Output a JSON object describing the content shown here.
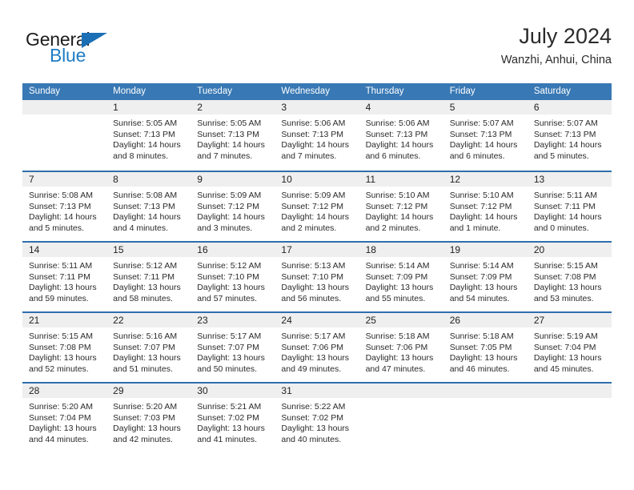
{
  "brand": {
    "word_one": "General",
    "word_two": "Blue",
    "triangle_color": "#1a6fb5",
    "blue_text_color": "#1f7dc4"
  },
  "header": {
    "title": "July 2024",
    "subtitle": "Wanzhi, Anhui, China"
  },
  "theme": {
    "header_bar_color": "#3878b4",
    "row_divider_color": "#2f6fad",
    "day_number_band_color": "#efefef"
  },
  "weekday_headers": [
    "Sunday",
    "Monday",
    "Tuesday",
    "Wednesday",
    "Thursday",
    "Friday",
    "Saturday"
  ],
  "weeks": [
    [
      {
        "day": "",
        "lines": []
      },
      {
        "day": "1",
        "lines": [
          "Sunrise: 5:05 AM",
          "Sunset: 7:13 PM",
          "Daylight: 14 hours",
          "and 8 minutes."
        ]
      },
      {
        "day": "2",
        "lines": [
          "Sunrise: 5:05 AM",
          "Sunset: 7:13 PM",
          "Daylight: 14 hours",
          "and 7 minutes."
        ]
      },
      {
        "day": "3",
        "lines": [
          "Sunrise: 5:06 AM",
          "Sunset: 7:13 PM",
          "Daylight: 14 hours",
          "and 7 minutes."
        ]
      },
      {
        "day": "4",
        "lines": [
          "Sunrise: 5:06 AM",
          "Sunset: 7:13 PM",
          "Daylight: 14 hours",
          "and 6 minutes."
        ]
      },
      {
        "day": "5",
        "lines": [
          "Sunrise: 5:07 AM",
          "Sunset: 7:13 PM",
          "Daylight: 14 hours",
          "and 6 minutes."
        ]
      },
      {
        "day": "6",
        "lines": [
          "Sunrise: 5:07 AM",
          "Sunset: 7:13 PM",
          "Daylight: 14 hours",
          "and 5 minutes."
        ]
      }
    ],
    [
      {
        "day": "7",
        "lines": [
          "Sunrise: 5:08 AM",
          "Sunset: 7:13 PM",
          "Daylight: 14 hours",
          "and 5 minutes."
        ]
      },
      {
        "day": "8",
        "lines": [
          "Sunrise: 5:08 AM",
          "Sunset: 7:13 PM",
          "Daylight: 14 hours",
          "and 4 minutes."
        ]
      },
      {
        "day": "9",
        "lines": [
          "Sunrise: 5:09 AM",
          "Sunset: 7:12 PM",
          "Daylight: 14 hours",
          "and 3 minutes."
        ]
      },
      {
        "day": "10",
        "lines": [
          "Sunrise: 5:09 AM",
          "Sunset: 7:12 PM",
          "Daylight: 14 hours",
          "and 2 minutes."
        ]
      },
      {
        "day": "11",
        "lines": [
          "Sunrise: 5:10 AM",
          "Sunset: 7:12 PM",
          "Daylight: 14 hours",
          "and 2 minutes."
        ]
      },
      {
        "day": "12",
        "lines": [
          "Sunrise: 5:10 AM",
          "Sunset: 7:12 PM",
          "Daylight: 14 hours",
          "and 1 minute."
        ]
      },
      {
        "day": "13",
        "lines": [
          "Sunrise: 5:11 AM",
          "Sunset: 7:11 PM",
          "Daylight: 14 hours",
          "and 0 minutes."
        ]
      }
    ],
    [
      {
        "day": "14",
        "lines": [
          "Sunrise: 5:11 AM",
          "Sunset: 7:11 PM",
          "Daylight: 13 hours",
          "and 59 minutes."
        ]
      },
      {
        "day": "15",
        "lines": [
          "Sunrise: 5:12 AM",
          "Sunset: 7:11 PM",
          "Daylight: 13 hours",
          "and 58 minutes."
        ]
      },
      {
        "day": "16",
        "lines": [
          "Sunrise: 5:12 AM",
          "Sunset: 7:10 PM",
          "Daylight: 13 hours",
          "and 57 minutes."
        ]
      },
      {
        "day": "17",
        "lines": [
          "Sunrise: 5:13 AM",
          "Sunset: 7:10 PM",
          "Daylight: 13 hours",
          "and 56 minutes."
        ]
      },
      {
        "day": "18",
        "lines": [
          "Sunrise: 5:14 AM",
          "Sunset: 7:09 PM",
          "Daylight: 13 hours",
          "and 55 minutes."
        ]
      },
      {
        "day": "19",
        "lines": [
          "Sunrise: 5:14 AM",
          "Sunset: 7:09 PM",
          "Daylight: 13 hours",
          "and 54 minutes."
        ]
      },
      {
        "day": "20",
        "lines": [
          "Sunrise: 5:15 AM",
          "Sunset: 7:08 PM",
          "Daylight: 13 hours",
          "and 53 minutes."
        ]
      }
    ],
    [
      {
        "day": "21",
        "lines": [
          "Sunrise: 5:15 AM",
          "Sunset: 7:08 PM",
          "Daylight: 13 hours",
          "and 52 minutes."
        ]
      },
      {
        "day": "22",
        "lines": [
          "Sunrise: 5:16 AM",
          "Sunset: 7:07 PM",
          "Daylight: 13 hours",
          "and 51 minutes."
        ]
      },
      {
        "day": "23",
        "lines": [
          "Sunrise: 5:17 AM",
          "Sunset: 7:07 PM",
          "Daylight: 13 hours",
          "and 50 minutes."
        ]
      },
      {
        "day": "24",
        "lines": [
          "Sunrise: 5:17 AM",
          "Sunset: 7:06 PM",
          "Daylight: 13 hours",
          "and 49 minutes."
        ]
      },
      {
        "day": "25",
        "lines": [
          "Sunrise: 5:18 AM",
          "Sunset: 7:06 PM",
          "Daylight: 13 hours",
          "and 47 minutes."
        ]
      },
      {
        "day": "26",
        "lines": [
          "Sunrise: 5:18 AM",
          "Sunset: 7:05 PM",
          "Daylight: 13 hours",
          "and 46 minutes."
        ]
      },
      {
        "day": "27",
        "lines": [
          "Sunrise: 5:19 AM",
          "Sunset: 7:04 PM",
          "Daylight: 13 hours",
          "and 45 minutes."
        ]
      }
    ],
    [
      {
        "day": "28",
        "lines": [
          "Sunrise: 5:20 AM",
          "Sunset: 7:04 PM",
          "Daylight: 13 hours",
          "and 44 minutes."
        ]
      },
      {
        "day": "29",
        "lines": [
          "Sunrise: 5:20 AM",
          "Sunset: 7:03 PM",
          "Daylight: 13 hours",
          "and 42 minutes."
        ]
      },
      {
        "day": "30",
        "lines": [
          "Sunrise: 5:21 AM",
          "Sunset: 7:02 PM",
          "Daylight: 13 hours",
          "and 41 minutes."
        ]
      },
      {
        "day": "31",
        "lines": [
          "Sunrise: 5:22 AM",
          "Sunset: 7:02 PM",
          "Daylight: 13 hours",
          "and 40 minutes."
        ]
      },
      {
        "day": "",
        "lines": []
      },
      {
        "day": "",
        "lines": []
      },
      {
        "day": "",
        "lines": []
      }
    ]
  ]
}
